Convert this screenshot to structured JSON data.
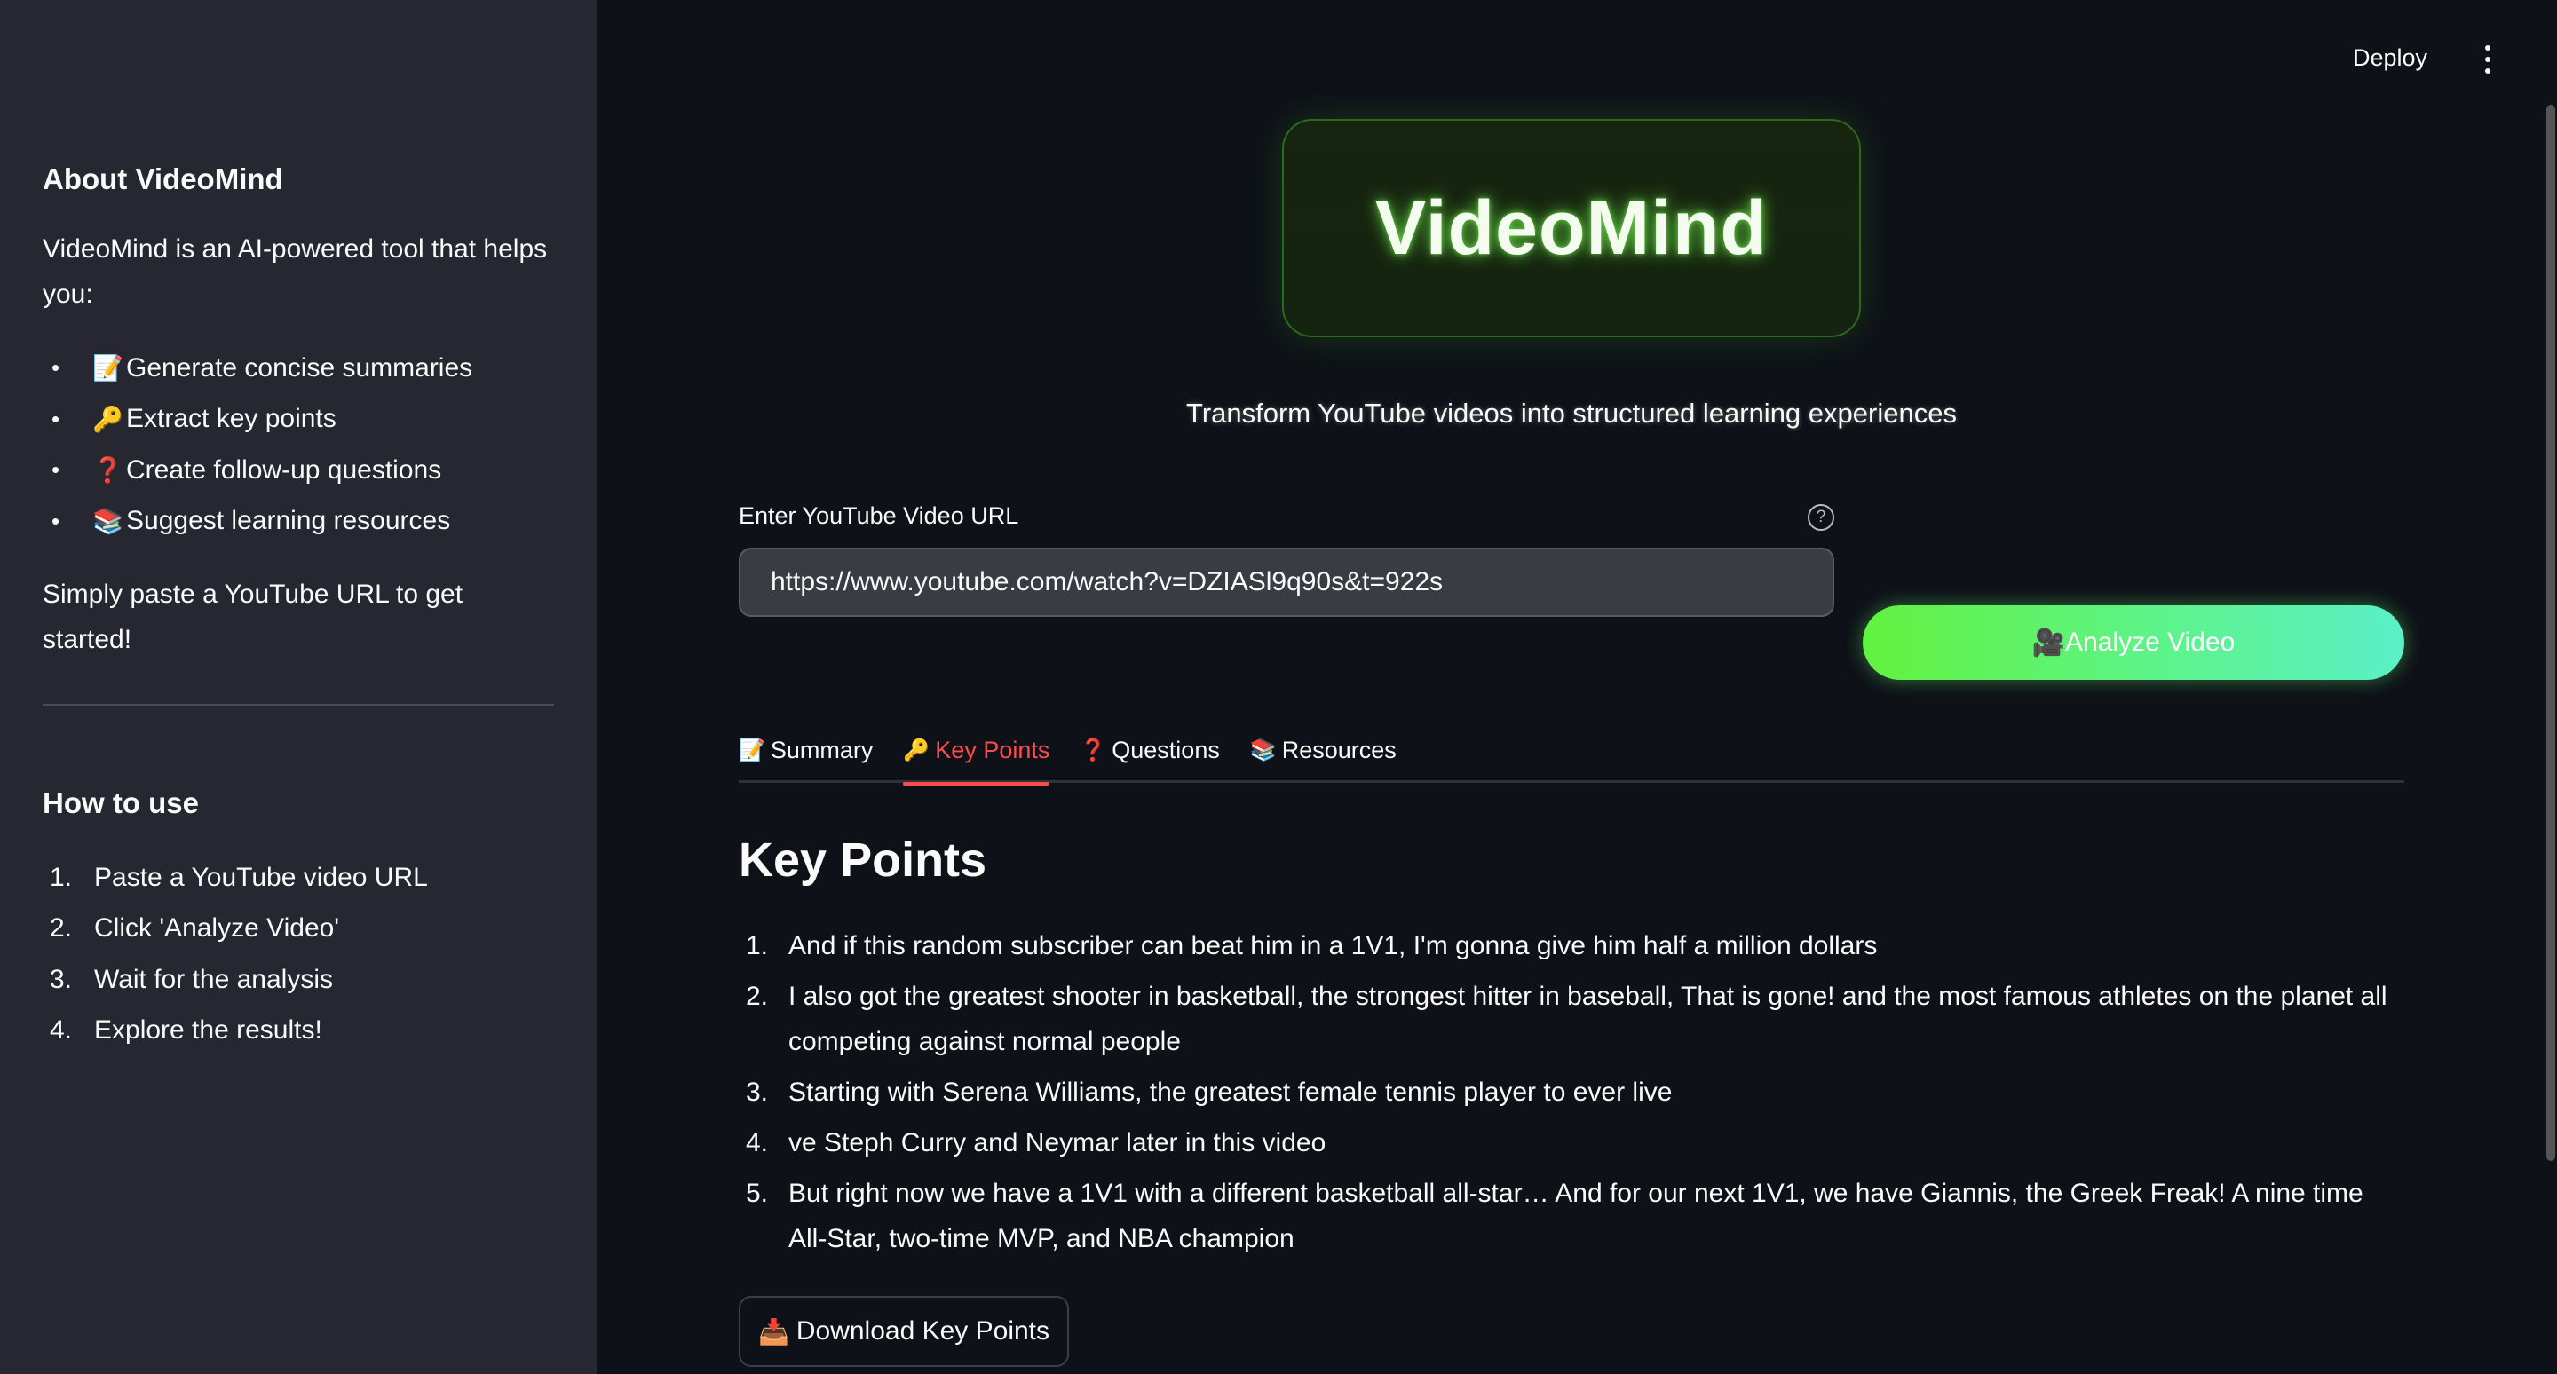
{
  "sidebar": {
    "about_heading": "About VideoMind",
    "about_text": "VideoMind is an AI-powered tool that helps you:",
    "features": [
      {
        "icon": "📝",
        "icon_name": "memo-icon",
        "label": "Generate concise summaries"
      },
      {
        "icon": "🔑",
        "icon_name": "key-icon",
        "label": "Extract key points"
      },
      {
        "icon": "❓",
        "icon_name": "question-icon",
        "label": "Create follow-up questions"
      },
      {
        "icon": "📚",
        "icon_name": "books-icon",
        "label": "Suggest learning resources"
      }
    ],
    "bullet": "•",
    "cta_text": "Simply paste a YouTube URL to get started!",
    "howto_heading": "How to use",
    "steps": [
      {
        "num": "1.",
        "label": "Paste a YouTube video URL"
      },
      {
        "num": "2.",
        "label": "Click 'Analyze Video'"
      },
      {
        "num": "3.",
        "label": "Wait for the analysis"
      },
      {
        "num": "4.",
        "label": "Explore the results!"
      }
    ]
  },
  "header": {
    "deploy_label": "Deploy"
  },
  "hero": {
    "title": "VideoMind",
    "subtitle": "Transform YouTube videos into structured learning experiences"
  },
  "input": {
    "label": "Enter YouTube Video URL",
    "help_glyph": "?",
    "value": "https://www.youtube.com/watch?v=DZIASl9q90s&t=922s"
  },
  "analyze": {
    "icon": "🎥",
    "label": "Analyze Video"
  },
  "tabs": [
    {
      "icon": "📝",
      "label": "Summary",
      "active": false
    },
    {
      "icon": "🔑",
      "label": "Key Points",
      "active": true
    },
    {
      "icon": "❓",
      "label": "Questions",
      "active": false
    },
    {
      "icon": "📚",
      "label": "Resources",
      "active": false
    }
  ],
  "key_points": {
    "title": "Key Points",
    "items": [
      {
        "num": "1.",
        "text": "And if this random subscriber can beat him in a 1V1, I'm gonna give him half a million dollars"
      },
      {
        "num": "2.",
        "text": "I also got the greatest shooter in basketball, the strongest hitter in baseball, That is gone! and the most famous athletes on the planet all competing against normal people"
      },
      {
        "num": "3.",
        "text": "Starting with Serena Williams, the greatest female tennis player to ever live"
      },
      {
        "num": "4.",
        "text": "ve Steph Curry and Neymar later in this video"
      },
      {
        "num": "5.",
        "text": "But right now we have a 1V1 with a different basketball all-star… And for our next 1V1, we have Giannis, the Greek Freak! A nine time All-Star, two-time MVP, and NBA champion"
      }
    ],
    "download_icon": "📥",
    "download_label": "Download Key Points"
  },
  "colors": {
    "accent_active_tab": "#ff4b4b",
    "analyze_gradient_start": "#62f23f",
    "analyze_gradient_end": "#5bf0c8",
    "sidebar_bg": "#262730",
    "main_bg": "#0e1117"
  }
}
